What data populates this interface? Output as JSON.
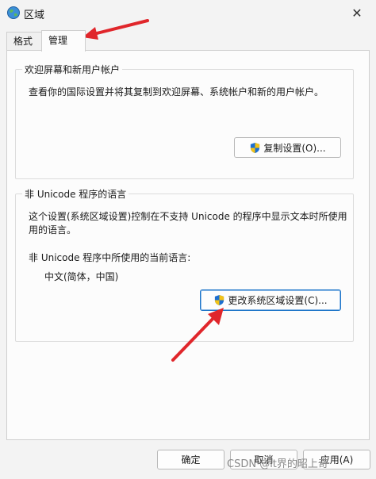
{
  "window": {
    "title": "区域",
    "close_glyph": "✕"
  },
  "tabs": [
    {
      "label": "格式"
    },
    {
      "label": "管理"
    }
  ],
  "welcome_group": {
    "legend": "欢迎屏幕和新用户帐户",
    "description": "查看你的国际设置并将其复制到欢迎屏幕、系统帐户和新的用户帐户。",
    "copy_button": "复制设置(O)..."
  },
  "unicode_group": {
    "legend": "非 Unicode 程序的语言",
    "description_line1": "这个设置(系统区域设置)控制在不支持 Unicode 的程序中显示文本时所使用",
    "description_line2": "用的语言。",
    "current_label": "非 Unicode 程序中所使用的当前语言:",
    "current_value": "中文(简体，中国)",
    "change_button": "更改系统区域设置(C)..."
  },
  "footer": {
    "ok": "确定",
    "cancel": "取消",
    "apply": "应用(A)"
  },
  "watermark": "CSDN @it界的昭上奇",
  "colors": {
    "arrow": "#e0262b",
    "focus": "#1a73c8",
    "shield_blue": "#1c6fd1",
    "shield_yellow": "#f3c318"
  },
  "icons": [
    "globe-icon",
    "close-icon",
    "uac-shield-icon",
    "annotation-arrow"
  ]
}
